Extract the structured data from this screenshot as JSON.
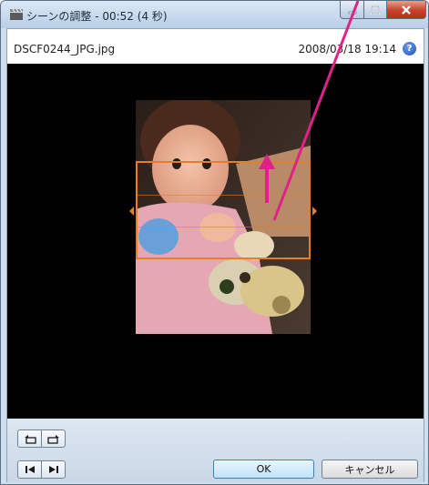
{
  "window": {
    "title": "シーンの調整 - 00:52 (4 秒)",
    "minimize_symbol": "—",
    "maximize_symbol": "☐",
    "close_symbol": "x"
  },
  "info": {
    "filename": "DSCF0244_JPG.jpg",
    "datetime": "2008/03/18 19:14",
    "help_symbol": "?"
  },
  "buttons": {
    "ok_label": "OK",
    "cancel_label": "キャンセル"
  },
  "icons": {
    "app": "film-clapper-icon",
    "help": "help-icon",
    "rotate_left": "rotate-left-icon",
    "rotate_right": "rotate-right-icon",
    "previous": "skip-previous-icon",
    "next": "skip-next-icon"
  },
  "colors": {
    "crop_frame": "#e37f26",
    "annotation_arrow": "#e0218a",
    "stage": "#000000"
  }
}
